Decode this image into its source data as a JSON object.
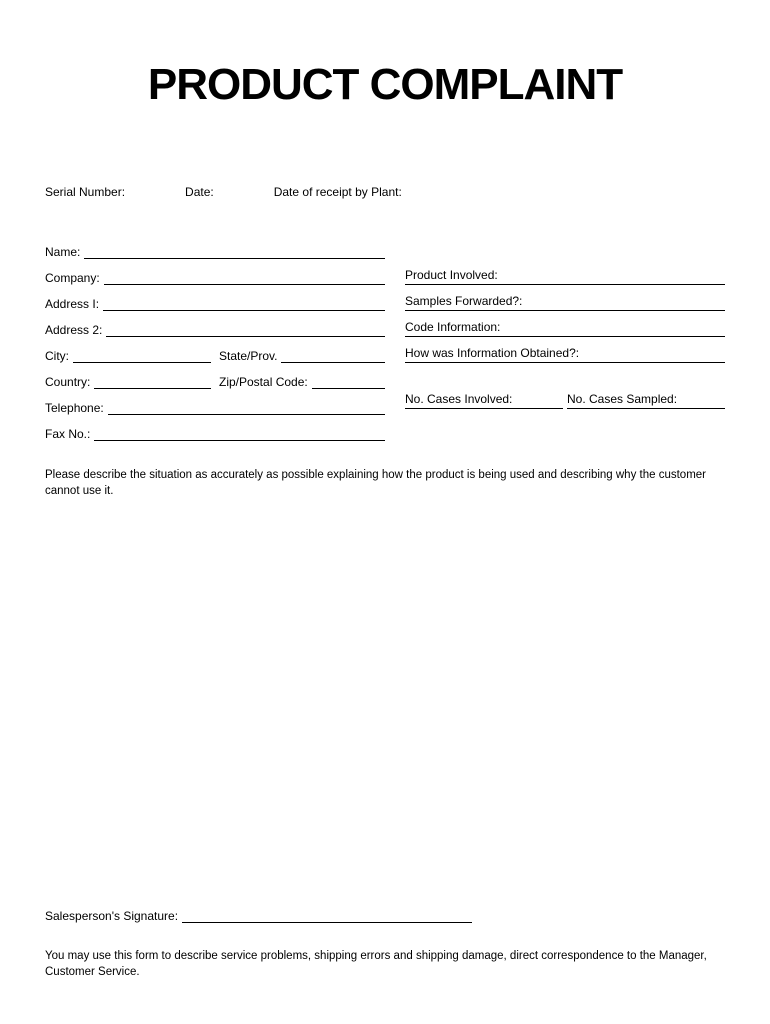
{
  "title": "PRODUCT COMPLAINT",
  "top": {
    "serial": "Serial Number:",
    "date": "Date:",
    "receipt": "Date of receipt by Plant:"
  },
  "left": {
    "name": "Name:",
    "company": "Company:",
    "address1": "Address I:",
    "address2": "Address 2:",
    "city": "City:",
    "state": "State/Prov.",
    "country": "Country:",
    "zip": "Zip/Postal Code:",
    "telephone": "Telephone:",
    "fax": "Fax No.:"
  },
  "right": {
    "product": "Product Involved:",
    "samples": "Samples Forwarded?:",
    "code": "Code Information:",
    "howInfo": "How was Information Obtained?:",
    "casesInvolved": "No. Cases Involved:",
    "casesSampled": "No. Cases Sampled:"
  },
  "instruction": "Please describe the situation as accurately as possible explaining how the product is being used and describing why the customer cannot use it.",
  "signature": "Salesperson's Signature:",
  "footer": "You may use this form to describe service problems, shipping errors and shipping damage, direct correspondence to the Manager, Customer Service."
}
